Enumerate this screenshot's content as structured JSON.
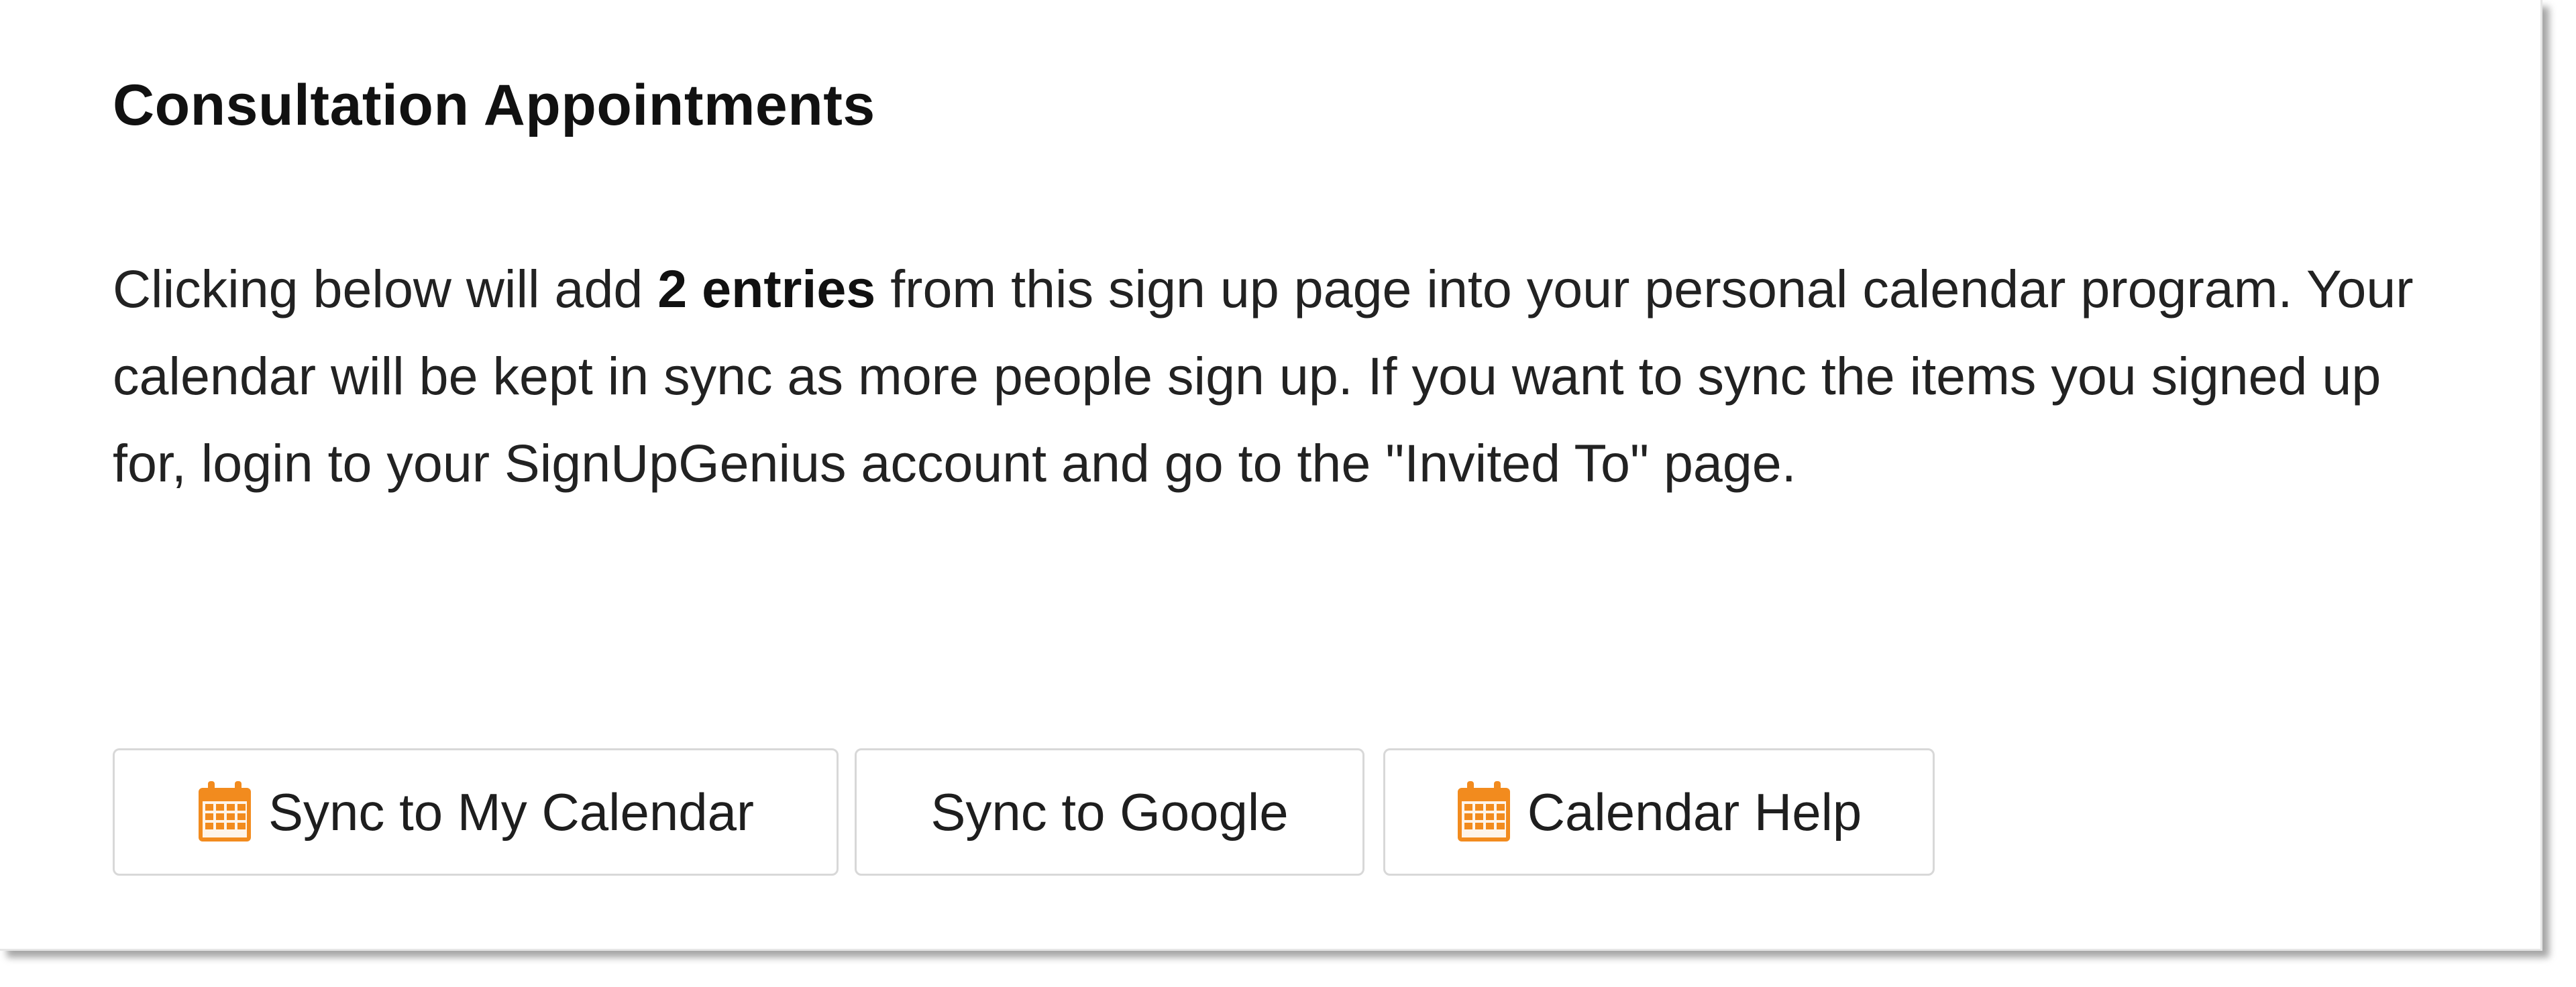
{
  "card": {
    "title": "Consultation Appointments",
    "description": {
      "before": "Clicking below will add ",
      "emphasis": "2 entries",
      "after": " from this sign up page into your personal calendar program. Your calendar will be kept in sync as more people sign up. If you want to sync the items you signed up for, login to your SignUpGenius account and go to the \"Invited To\" page."
    }
  },
  "buttons": {
    "sync_calendar": {
      "label": "Sync to My Calendar",
      "icon": "calendar-icon"
    },
    "sync_google": {
      "label": "Sync to Google"
    },
    "calendar_help": {
      "label": "Calendar Help",
      "icon": "calendar-icon"
    }
  },
  "colors": {
    "icon_accent": "#f28b1e",
    "text": "#222222",
    "button_border": "#d8d8d8"
  }
}
